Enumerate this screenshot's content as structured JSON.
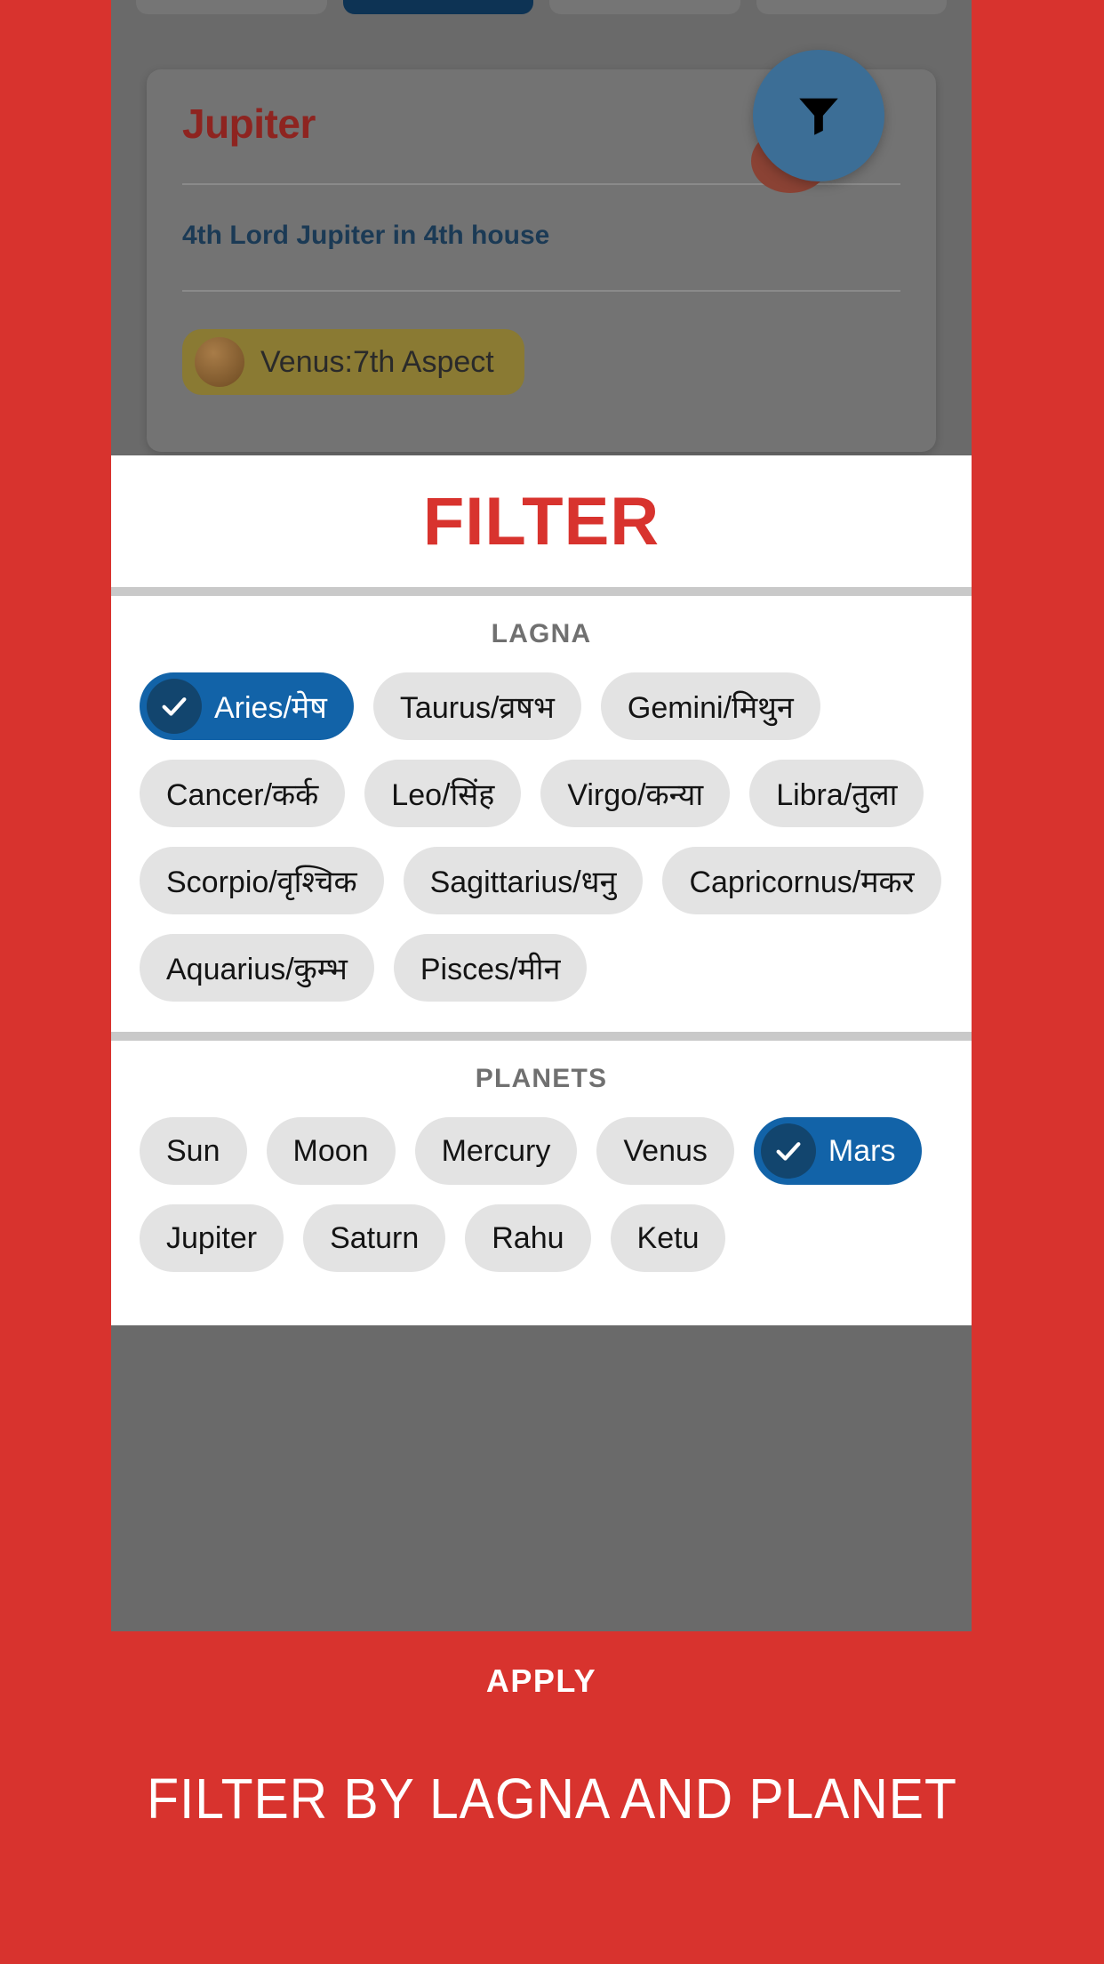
{
  "background": {
    "tabs": [
      {
        "label": "",
        "active": false
      },
      {
        "label": "",
        "active": true
      },
      {
        "label": "",
        "active": false
      },
      {
        "label": "",
        "active": false
      }
    ],
    "card": {
      "title": "Jupiter",
      "subtitle": "4th Lord Jupiter in 4th house",
      "aspect_chip": "Venus:7th Aspect"
    },
    "fab_icon": "filter-funnel-icon",
    "fab_color": "#3c6e96"
  },
  "dialog": {
    "title": "FILTER",
    "lagna": {
      "label": "LAGNA",
      "chips": [
        {
          "label": "Aries/मेष",
          "selected": true
        },
        {
          "label": "Taurus/व्रषभ",
          "selected": false
        },
        {
          "label": "Gemini/मिथुन",
          "selected": false
        },
        {
          "label": "Cancer/कर्क",
          "selected": false
        },
        {
          "label": "Leo/सिंह",
          "selected": false
        },
        {
          "label": "Virgo/कन्या",
          "selected": false
        },
        {
          "label": "Libra/तुला",
          "selected": false
        },
        {
          "label": "Scorpio/वृश्चिक",
          "selected": false
        },
        {
          "label": "Sagittarius/धनु",
          "selected": false
        },
        {
          "label": "Capricornus/मकर",
          "selected": false
        },
        {
          "label": "Aquarius/कुम्भ",
          "selected": false
        },
        {
          "label": "Pisces/मीन",
          "selected": false
        }
      ]
    },
    "planets": {
      "label": "PLANETS",
      "chips": [
        {
          "label": "Sun",
          "selected": false
        },
        {
          "label": "Moon",
          "selected": false
        },
        {
          "label": "Mercury",
          "selected": false
        },
        {
          "label": "Venus",
          "selected": false
        },
        {
          "label": "Mars",
          "selected": true
        },
        {
          "label": "Jupiter",
          "selected": false
        },
        {
          "label": "Saturn",
          "selected": false
        },
        {
          "label": "Rahu",
          "selected": false
        },
        {
          "label": "Ketu",
          "selected": false
        }
      ]
    },
    "apply_label": "APPLY"
  },
  "caption": "FILTER BY LAGNA AND PLANET",
  "colors": {
    "brand_red": "#d8332e",
    "selected_chip": "#1263a8",
    "chip": "#e3e3e3",
    "title_red": "#d8332e",
    "section_label": "#707070"
  }
}
